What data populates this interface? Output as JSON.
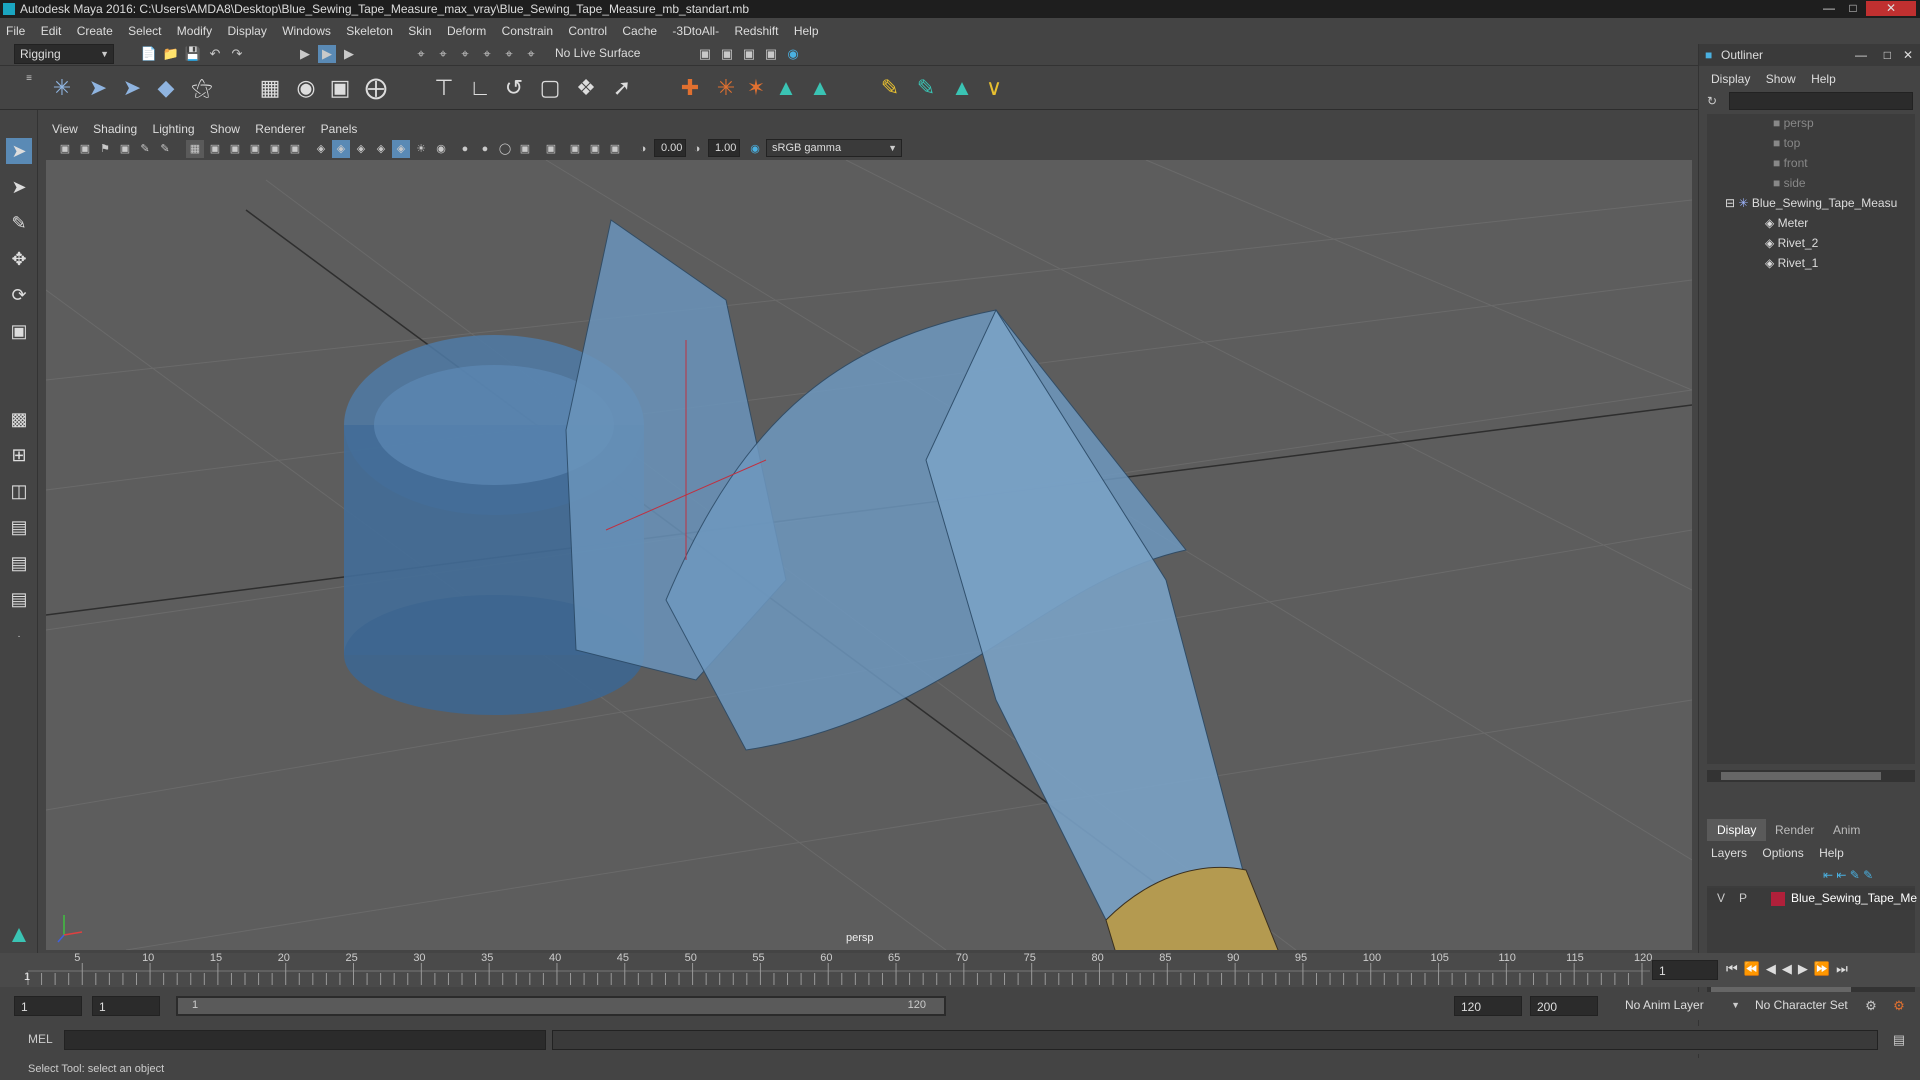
{
  "window": {
    "title": "Autodesk Maya 2016: C:\\Users\\AMDA8\\Desktop\\Blue_Sewing_Tape_Measure_max_vray\\Blue_Sewing_Tape_Measure_mb_standart.mb"
  },
  "menubar": [
    "File",
    "Edit",
    "Create",
    "Select",
    "Modify",
    "Display",
    "Windows",
    "Skeleton",
    "Skin",
    "Deform",
    "Constrain",
    "Control",
    "Cache",
    "-3DtoAll-",
    "Redshift",
    "Help"
  ],
  "statusline": {
    "menuset": "Rigging",
    "live_surface": "No Live Surface"
  },
  "panel": {
    "menu": [
      "View",
      "Shading",
      "Lighting",
      "Show",
      "Renderer",
      "Panels"
    ],
    "exposure": "0.00",
    "gamma": "1.00",
    "color_space": "sRGB gamma",
    "camera_label": "persp"
  },
  "outliner": {
    "title": "Outliner",
    "menu": [
      "Display",
      "Show",
      "Help"
    ],
    "items": [
      {
        "label": "persp",
        "icon": "camera-icon",
        "dim": true
      },
      {
        "label": "top",
        "icon": "camera-icon",
        "dim": true
      },
      {
        "label": "front",
        "icon": "camera-icon",
        "dim": true
      },
      {
        "label": "side",
        "icon": "camera-icon",
        "dim": true
      },
      {
        "label": "Blue_Sewing_Tape_Measu",
        "icon": "joint-icon",
        "dim": false
      },
      {
        "label": "Meter",
        "icon": "mesh-icon",
        "dim": false
      },
      {
        "label": "Rivet_2",
        "icon": "mesh-icon",
        "dim": false
      },
      {
        "label": "Rivet_1",
        "icon": "mesh-icon",
        "dim": false
      }
    ]
  },
  "layer_editor": {
    "tabs": [
      "Display",
      "Render",
      "Anim"
    ],
    "menu": [
      "Layers",
      "Options",
      "Help"
    ],
    "layer": {
      "v": "V",
      "p": "P",
      "name": "Blue_Sewing_Tape_Me",
      "color": "#b0203a"
    }
  },
  "timeline": {
    "ticks": [
      "5",
      "10",
      "15",
      "20",
      "25",
      "30",
      "35",
      "40",
      "45",
      "50",
      "55",
      "60",
      "65",
      "70",
      "75",
      "80",
      "85",
      "90",
      "95",
      "100",
      "105",
      "110",
      "115",
      "120"
    ],
    "start_label": "1",
    "current_frame": "1"
  },
  "range": {
    "start": "1",
    "playback_start": "1",
    "slider_start": "1",
    "slider_end": "120",
    "playback_end": "120",
    "end": "200",
    "anim_layer": "No Anim Layer",
    "character_set": "No Character Set"
  },
  "command": {
    "label": "MEL"
  },
  "helpline": "Select Tool: select an object",
  "colors": {
    "tape_blue": "#5b85ad",
    "metal_tip": "#b49a50",
    "viewport_bg": "#5d5d5d"
  }
}
